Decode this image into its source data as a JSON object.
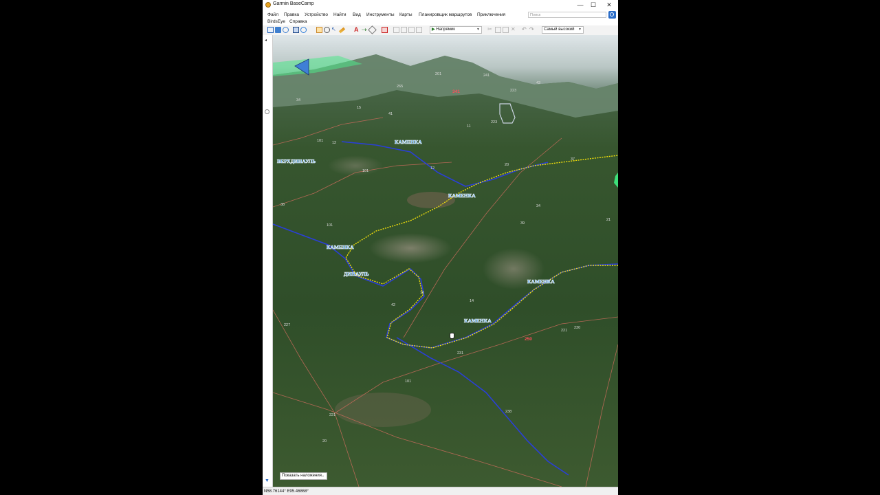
{
  "window": {
    "title": "Garmin BaseCamp",
    "minimize": "—",
    "maximize": "☐",
    "close": "✕"
  },
  "menu": {
    "items": [
      "Файл",
      "Правка",
      "Устройство",
      "Найти",
      "Вид",
      "Инструменты",
      "Карты",
      "Планировщик маршрутов",
      "Приключения"
    ],
    "items_row2": [
      "BirdsEye",
      "Справка"
    ],
    "search_placeholder": "Поиск"
  },
  "toolbar": {
    "route_mode": "Напрямик",
    "detail_level": "Самый высокий"
  },
  "map": {
    "river_labels": [
      "КАМЕНКА",
      "ВЕРХДИНАУЛЬ",
      "КАМЕНКА",
      "КАМЕНКА",
      "ДИНАУЛЬ",
      "КАМЕНКА",
      "КАМЕНКА"
    ],
    "elevations": [
      "201",
      "241",
      "265",
      "223",
      "43",
      "34",
      "15",
      "41",
      "11",
      "223",
      "101",
      "12",
      "12",
      "20",
      "101",
      "37",
      "38",
      "34",
      "101",
      "39",
      "21",
      "16",
      "14",
      "42",
      "227",
      "230",
      "221",
      "231",
      "101",
      "238",
      "221",
      "20"
    ],
    "peaks": [
      "341",
      "250"
    ],
    "overlay_button": "Показать наложения",
    "colors": {
      "track": "#f5e20a",
      "river": "#2a3fd8",
      "road": "#c46a5a",
      "terrain": "#3b5c32"
    }
  },
  "status": {
    "coords": "N58.76144° E95.46868°"
  }
}
